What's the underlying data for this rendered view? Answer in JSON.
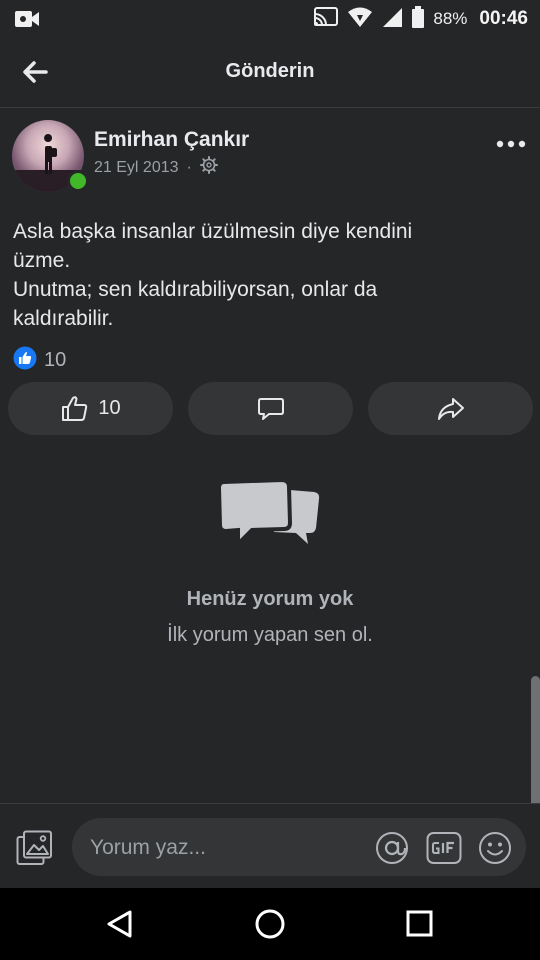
{
  "status_bar": {
    "battery": "88%",
    "time": "00:46",
    "icons": [
      "video-camera-icon",
      "cast-icon",
      "wifi-icon",
      "cell-signal-icon",
      "battery-icon"
    ]
  },
  "header": {
    "title": "Gönderin",
    "back_icon": "arrow-left-icon"
  },
  "post": {
    "author": "Emirhan Çankır",
    "date": "21 Eyl 2013",
    "separator": "·",
    "privacy_icon": "gear-icon",
    "text": "Asla başka insanlar üzülmesin diye kendini\nüzme.\nUnutma; sen kaldırabiliyorsan, onlar da\nkaldırabilir.",
    "reactions_count": "10",
    "online": true
  },
  "actions": {
    "like_count": "10",
    "like_icon": "thumbs-up-icon",
    "comment_icon": "comment-icon",
    "share_icon": "share-icon"
  },
  "comments": {
    "empty_title": "Henüz yorum yok",
    "empty_subtitle": "İlk yorum yapan sen ol."
  },
  "composer": {
    "placeholder": "Yorum yaz...",
    "icons": [
      "photo-icon",
      "at-sign-icon",
      "gif-icon",
      "emoji-icon"
    ]
  },
  "nav": {
    "icons": [
      "back-triangle-icon",
      "home-circle-icon",
      "recents-square-icon"
    ]
  },
  "colors": {
    "background": "#252627",
    "surface": "#343537",
    "text": "#e6e8ea",
    "muted": "#9aa0a6",
    "online": "#42b72a",
    "like_blue": "#1877f2"
  }
}
